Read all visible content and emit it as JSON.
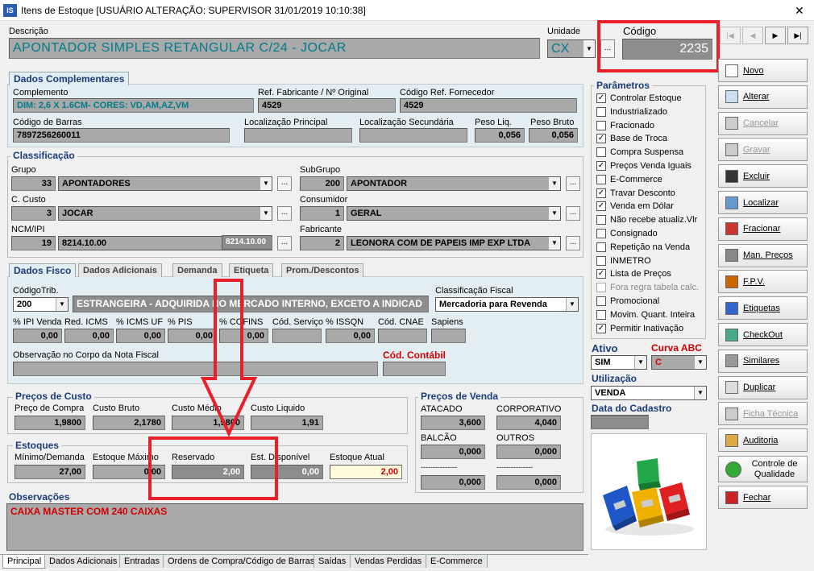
{
  "window": {
    "title": "Itens de Estoque  [USUÁRIO ALTERAÇÃO: SUPERVISOR 31/01/2019 10:10:38]",
    "close": "✕",
    "app_icon": "IS"
  },
  "header": {
    "descricao_label": "Descrição",
    "descricao": "APONTADOR SIMPLES RETANGULAR  C/24 - JOCAR",
    "unidade_label": "Unidade",
    "unidade": "CX",
    "codigo_label": "Código",
    "codigo": "2235"
  },
  "nav": {
    "first": "|◀",
    "prev": "◀",
    "next": "▶",
    "last": "▶|"
  },
  "complementares": {
    "title": "Dados Complementares",
    "complemento_label": "Complemento",
    "complemento": "DIM: 2,6 X 1.6CM- CORES: VD,AM,AZ,VM",
    "ref_fab_label": "Ref. Fabricante / Nº Original",
    "ref_fab": "4529",
    "cod_ref_label": "Código Ref. Fornecedor",
    "cod_ref": "4529",
    "barras_label": "Código de Barras",
    "barras": "7897256260011",
    "loc_pri_label": "Localização Principal",
    "loc_pri": "",
    "loc_sec_label": "Localização Secundária",
    "loc_sec": "",
    "peso_liq_label": "Peso Liq.",
    "peso_liq": "0,056",
    "peso_bruto_label": "Peso Bruto",
    "peso_bruto": "0,056"
  },
  "classificacao": {
    "title": "Classificação",
    "grupo_label": "Grupo",
    "grupo_cod": "33",
    "grupo": "APONTADORES",
    "subgrupo_label": "SubGrupo",
    "subgrupo_cod": "200",
    "subgrupo": "APONTADOR",
    "custo_label": "C. Custo",
    "custo_cod": "3",
    "custo": "JOCAR",
    "consumidor_label": "Consumidor",
    "consumidor_cod": "1",
    "consumidor": "GERAL",
    "ncm_label": "NCM/IPI",
    "ncm_cod": "19",
    "ncm": "8214.10.00",
    "ncm2": "8214.10.00",
    "fabricante_label": "Fabricante",
    "fabricante_cod": "2",
    "fabricante": "LEONORA COM DE PAPEIS IMP EXP LTDA"
  },
  "fisco_tabs": [
    "Dados Fisco",
    "Dados Adicionais",
    "Demanda",
    "Etiqueta",
    "Prom./Descontos"
  ],
  "fisco": {
    "cod_trib_label": "CódigoTrib.",
    "cod_trib": "200",
    "cod_trib_desc": "ESTRANGEIRA - ADQUIRIDA NO MERCADO INTERNO, EXCETO A INDICAD",
    "class_fiscal_label": "Classificação Fiscal",
    "class_fiscal": "Mercadoria para Revenda",
    "ipi_label": "% IPI Venda",
    "ipi": "0,00",
    "red_icms_label": "Red. ICMS",
    "red_icms": "0,00",
    "icms_uf_label": "% ICMS UF",
    "icms_uf": "0,00",
    "pis_label": "% PIS",
    "pis": "0,00",
    "cofins_label": "% COFINS",
    "cofins": "0,00",
    "cod_serv_label": "Cód. Serviço",
    "cod_serv": "",
    "issqn_label": "% ISSQN",
    "issqn": "0,00",
    "cnae_label": "Cód. CNAE",
    "cnae": "",
    "sapiens_label": "Sapiens",
    "sapiens": "",
    "obs_nf_label": "Observação no Corpo da Nota Fiscal",
    "obs_nf": "",
    "cod_contabil_label": "Cód. Contábil",
    "cod_contabil": ""
  },
  "custo": {
    "title": "Preços de Custo",
    "compra_label": "Preço de Compra",
    "compra": "1,9800",
    "bruto_label": "Custo Bruto",
    "bruto": "2,1780",
    "medio_label": "Custo Médio",
    "medio": "1,9800",
    "liquido_label": "Custo Liquido",
    "liquido": "1,91"
  },
  "estoques": {
    "title": "Estoques",
    "min_label": "Mínimo/Demanda",
    "min": "27,00",
    "max_label": "Estoque Máximo",
    "max": "0,00",
    "reservado_label": "Reservado",
    "reservado": "2,00",
    "disp_label": "Est. Disponível",
    "disp": "0,00",
    "atual_label": "Estoque Atual",
    "atual": "2,00"
  },
  "venda": {
    "title": "Preços de Venda",
    "atacado_label": "ATACADO",
    "atacado": "3,600",
    "corporativo_label": "CORPORATIVO",
    "corporativo": "4,040",
    "balcao_label": "BALCÃO",
    "balcao": "0,000",
    "outros_label": "OUTROS",
    "outros": "0,000",
    "d1_label": "---------------",
    "d1": "0,000",
    "d2_label": "---------------",
    "d2": "0,000"
  },
  "observacoes": {
    "title": "Observações",
    "text": "CAIXA MASTER COM 240 CAIXAS"
  },
  "bottom_tabs": [
    "Principal",
    "Dados Adicionais",
    "Entradas",
    "Ordens de Compra/Código de Barras",
    "Saídas",
    "Vendas Perdidas",
    "E-Commerce"
  ],
  "parametros": {
    "title": "Parâmetros",
    "items": [
      {
        "label": "Controlar Estoque",
        "checked": true,
        "enabled": true
      },
      {
        "label": "Industrializado",
        "checked": false,
        "enabled": true
      },
      {
        "label": "Fracionado",
        "checked": false,
        "enabled": true
      },
      {
        "label": "Base de Troca",
        "checked": true,
        "enabled": true
      },
      {
        "label": "Compra Suspensa",
        "checked": false,
        "enabled": true
      },
      {
        "label": "Preços Venda Iguais",
        "checked": true,
        "enabled": true
      },
      {
        "label": "E-Commerce",
        "checked": false,
        "enabled": true
      },
      {
        "label": "Travar Desconto",
        "checked": true,
        "enabled": true
      },
      {
        "label": "Venda em Dólar",
        "checked": true,
        "enabled": true
      },
      {
        "label": "Não recebe atualiz.Vlr",
        "checked": false,
        "enabled": true
      },
      {
        "label": "Consignado",
        "checked": false,
        "enabled": true
      },
      {
        "label": "Repetição na Venda",
        "checked": false,
        "enabled": true
      },
      {
        "label": "INMETRO",
        "checked": false,
        "enabled": true
      },
      {
        "label": "Lista de Preços",
        "checked": true,
        "enabled": true
      },
      {
        "label": "Fora regra tabela calc.",
        "checked": false,
        "enabled": false
      },
      {
        "label": "Promocional",
        "checked": false,
        "enabled": true
      },
      {
        "label": "Movim. Quant. Inteira",
        "checked": false,
        "enabled": true
      },
      {
        "label": "Permitir Inativação",
        "checked": true,
        "enabled": true
      }
    ]
  },
  "status": {
    "ativo_label": "Ativo",
    "ativo": "SIM",
    "curva_label": "Curva ABC",
    "curva": "C",
    "utilizacao_label": "Utilização",
    "utilizacao": "VENDA",
    "data_cadastro_label": "Data do Cadastro",
    "data_cadastro": ""
  },
  "buttons": [
    {
      "label": "Novo",
      "icon": "new-doc-icon",
      "enabled": true
    },
    {
      "label": "Alterar",
      "icon": "edit-icon",
      "enabled": true
    },
    {
      "label": "Cancelar",
      "icon": "cancel-icon",
      "enabled": false
    },
    {
      "label": "Gravar",
      "icon": "save-icon",
      "enabled": false
    },
    {
      "label": "Excluir",
      "icon": "trash-icon",
      "enabled": true
    },
    {
      "label": "Localizar",
      "icon": "search-icon",
      "enabled": true
    },
    {
      "label": "Fracionar",
      "icon": "split-icon",
      "enabled": true
    },
    {
      "label": "Man. Preços",
      "icon": "price-icon",
      "enabled": true
    },
    {
      "label": "F.P.V.",
      "icon": "fpv-icon",
      "enabled": true
    },
    {
      "label": "Etiquetas",
      "icon": "label-icon",
      "enabled": true
    },
    {
      "label": "CheckOut",
      "icon": "grid-icon",
      "enabled": true
    },
    {
      "label": "Similares",
      "icon": "similar-icon",
      "enabled": true
    },
    {
      "label": "Duplicar",
      "icon": "duplicate-icon",
      "enabled": true
    },
    {
      "label": "Ficha Técnica",
      "icon": "sheet-icon",
      "enabled": false
    },
    {
      "label": "Auditoria",
      "icon": "audit-icon",
      "enabled": true
    },
    {
      "label": "Controle de Qualidade",
      "icon": "quality-icon",
      "enabled": true
    },
    {
      "label": "Fechar",
      "icon": "exit-icon",
      "enabled": true
    }
  ],
  "colors": {
    "highlight": "#e8202a",
    "teal": "#007b8a",
    "title_blue": "#1a3c7a",
    "red_text": "#d00000"
  }
}
